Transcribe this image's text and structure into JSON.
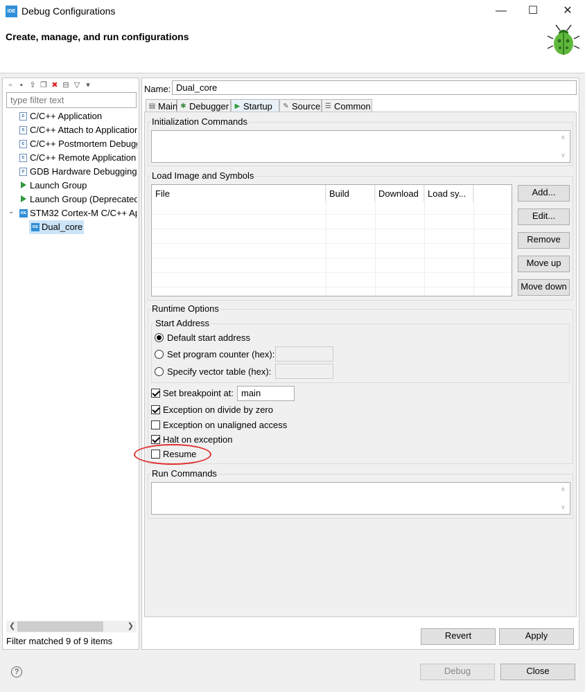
{
  "window": {
    "title": "Debug Configurations",
    "app_icon": "IDE",
    "minimize_glyph": "—",
    "maximize_glyph": "☐",
    "close_glyph": "✕"
  },
  "header": {
    "heading": "Create, manage, and run configurations",
    "icon": "bug-icon"
  },
  "left": {
    "toolbar_icons": [
      "new-config-icon",
      "new-proto-icon",
      "export-icon",
      "duplicate-icon",
      "delete-icon",
      "collapse-icon",
      "filter-icon",
      "menu-icon"
    ],
    "filter_placeholder": "type filter text",
    "tree": [
      {
        "label": "C/C++ Application",
        "icon": "c-icon",
        "level": 1
      },
      {
        "label": "C/C++ Attach to Application",
        "icon": "c-icon",
        "level": 1
      },
      {
        "label": "C/C++ Postmortem Debugger",
        "icon": "c-icon",
        "level": 1
      },
      {
        "label": "C/C++ Remote Application",
        "icon": "c-icon",
        "level": 1
      },
      {
        "label": "GDB Hardware Debugging",
        "icon": "c-icon",
        "level": 1
      },
      {
        "label": "Launch Group",
        "icon": "launch-icon",
        "level": 1
      },
      {
        "label": "Launch Group (Deprecated)",
        "icon": "launch-icon",
        "level": 1
      },
      {
        "label": "STM32 Cortex-M C/C++ Application",
        "icon": "ide-icon",
        "level": 1,
        "expanded": true
      },
      {
        "label": "Dual_core",
        "icon": "ide-icon",
        "level": 2,
        "selected": true
      }
    ],
    "filter_status": "Filter matched 9 of 9 items"
  },
  "right": {
    "name_label": "Name:",
    "name_value": "Dual_core",
    "tabs": [
      {
        "label": "Main",
        "icon": "main-tab-icon"
      },
      {
        "label": "Debugger",
        "icon": "debugger-tab-icon"
      },
      {
        "label": "Startup",
        "icon": "startup-tab-icon",
        "active": true
      },
      {
        "label": "Source",
        "icon": "source-tab-icon"
      },
      {
        "label": "Common",
        "icon": "common-tab-icon"
      }
    ],
    "init_commands": {
      "title": "Initialization Commands"
    },
    "load_image": {
      "title": "Load Image and Symbols",
      "columns": [
        "File",
        "Build",
        "Download",
        "Load sy..."
      ],
      "buttons": [
        "Add...",
        "Edit...",
        "Remove",
        "Move up",
        "Move down"
      ]
    },
    "runtime": {
      "title": "Runtime Options",
      "start_address": {
        "title": "Start Address",
        "options": [
          {
            "label": "Default start address",
            "checked": true
          },
          {
            "label": "Set program counter (hex):",
            "checked": false
          },
          {
            "label": "Specify vector table (hex):",
            "checked": false
          }
        ]
      },
      "set_breakpoint": {
        "label": "Set breakpoint at:",
        "checked": true,
        "value": "main"
      },
      "exception_divide": {
        "label": "Exception on divide by zero",
        "checked": true
      },
      "exception_unaligned": {
        "label": "Exception on unaligned access",
        "checked": false
      },
      "halt_on_exception": {
        "label": "Halt on exception",
        "checked": true
      },
      "resume": {
        "label": "Resume",
        "checked": false
      }
    },
    "run_commands": {
      "title": "Run Commands"
    },
    "revert_label": "Revert",
    "apply_label": "Apply"
  },
  "footer": {
    "help_glyph": "?",
    "debug_label": "Debug",
    "close_label": "Close"
  },
  "colors": {
    "annotation": "#e03030",
    "accent": "#2f8fd8"
  }
}
